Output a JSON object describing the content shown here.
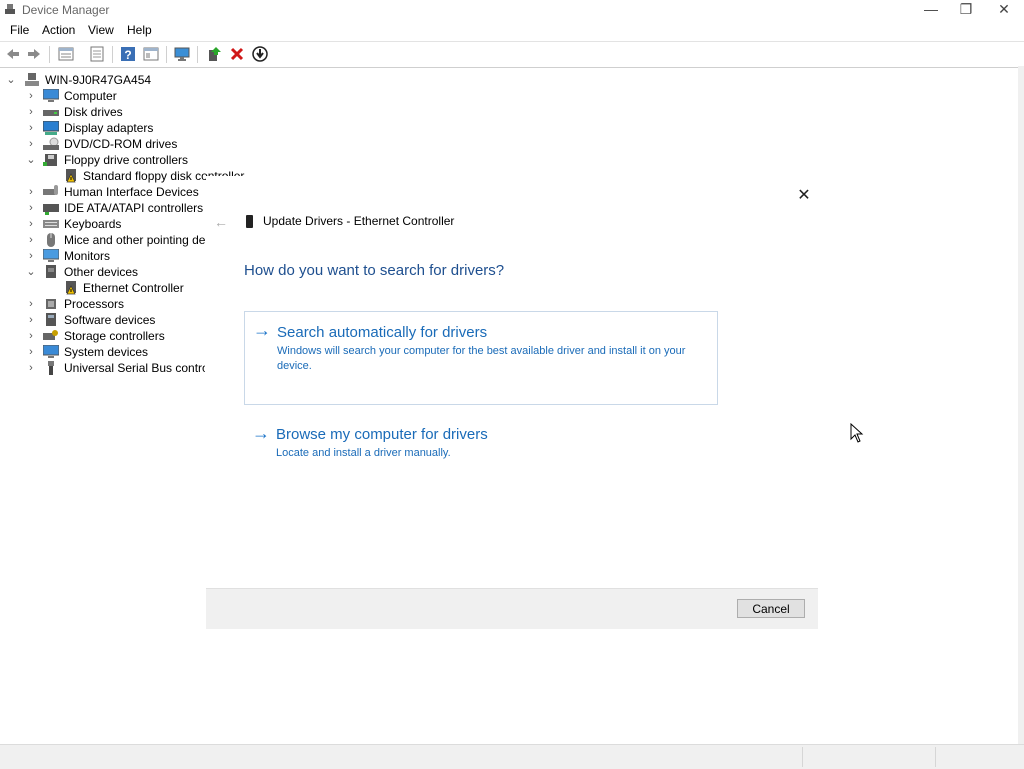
{
  "window": {
    "title": "Device Manager"
  },
  "window_controls": [
    "—",
    "❐",
    "✕"
  ],
  "menu": [
    "File",
    "Action",
    "View",
    "Help"
  ],
  "toolbar": [
    "back-icon",
    "forward-icon",
    "properties-icon",
    "help-icon",
    "view-icon",
    "scan-hardware-icon",
    "add-driver-icon",
    "uninstall-icon",
    "download-driver-icon"
  ],
  "tree": {
    "root": "WIN-9J0R47GA454",
    "items": [
      {
        "label": "Computer",
        "expanded": false
      },
      {
        "label": "Disk drives",
        "expanded": false
      },
      {
        "label": "Display adapters",
        "expanded": false
      },
      {
        "label": "DVD/CD-ROM drives",
        "expanded": false
      },
      {
        "label": "Floppy drive controllers",
        "expanded": true,
        "children": [
          "Standard floppy disk controller"
        ]
      },
      {
        "label": "Human Interface Devices",
        "expanded": false
      },
      {
        "label": "IDE ATA/ATAPI controllers",
        "expanded": false
      },
      {
        "label": "Keyboards",
        "expanded": false
      },
      {
        "label": "Mice and other pointing device",
        "expanded": false
      },
      {
        "label": "Monitors",
        "expanded": false
      },
      {
        "label": "Other devices",
        "expanded": true,
        "children": [
          "Ethernet Controller"
        ]
      },
      {
        "label": "Processors",
        "expanded": false
      },
      {
        "label": "Software devices",
        "expanded": false
      },
      {
        "label": "Storage controllers",
        "expanded": false
      },
      {
        "label": "System devices",
        "expanded": false
      },
      {
        "label": "Universal Serial Bus controllers",
        "expanded": false
      }
    ]
  },
  "dialog": {
    "title": "Update Drivers - Ethernet Controller",
    "question": "How do you want to search for drivers?",
    "options": [
      {
        "title": "Search automatically for drivers",
        "description": "Windows will search your computer for the best available driver and install it on your device."
      },
      {
        "title": "Browse my computer for drivers",
        "description": "Locate and install a driver manually."
      }
    ],
    "cancel_label": "Cancel",
    "close_glyph": "✕",
    "back_glyph": "←",
    "arrow_glyph": "→"
  },
  "colors": {
    "accent": "#1a6bb8",
    "question": "#1e4f8f",
    "warning": "#f2c200"
  }
}
